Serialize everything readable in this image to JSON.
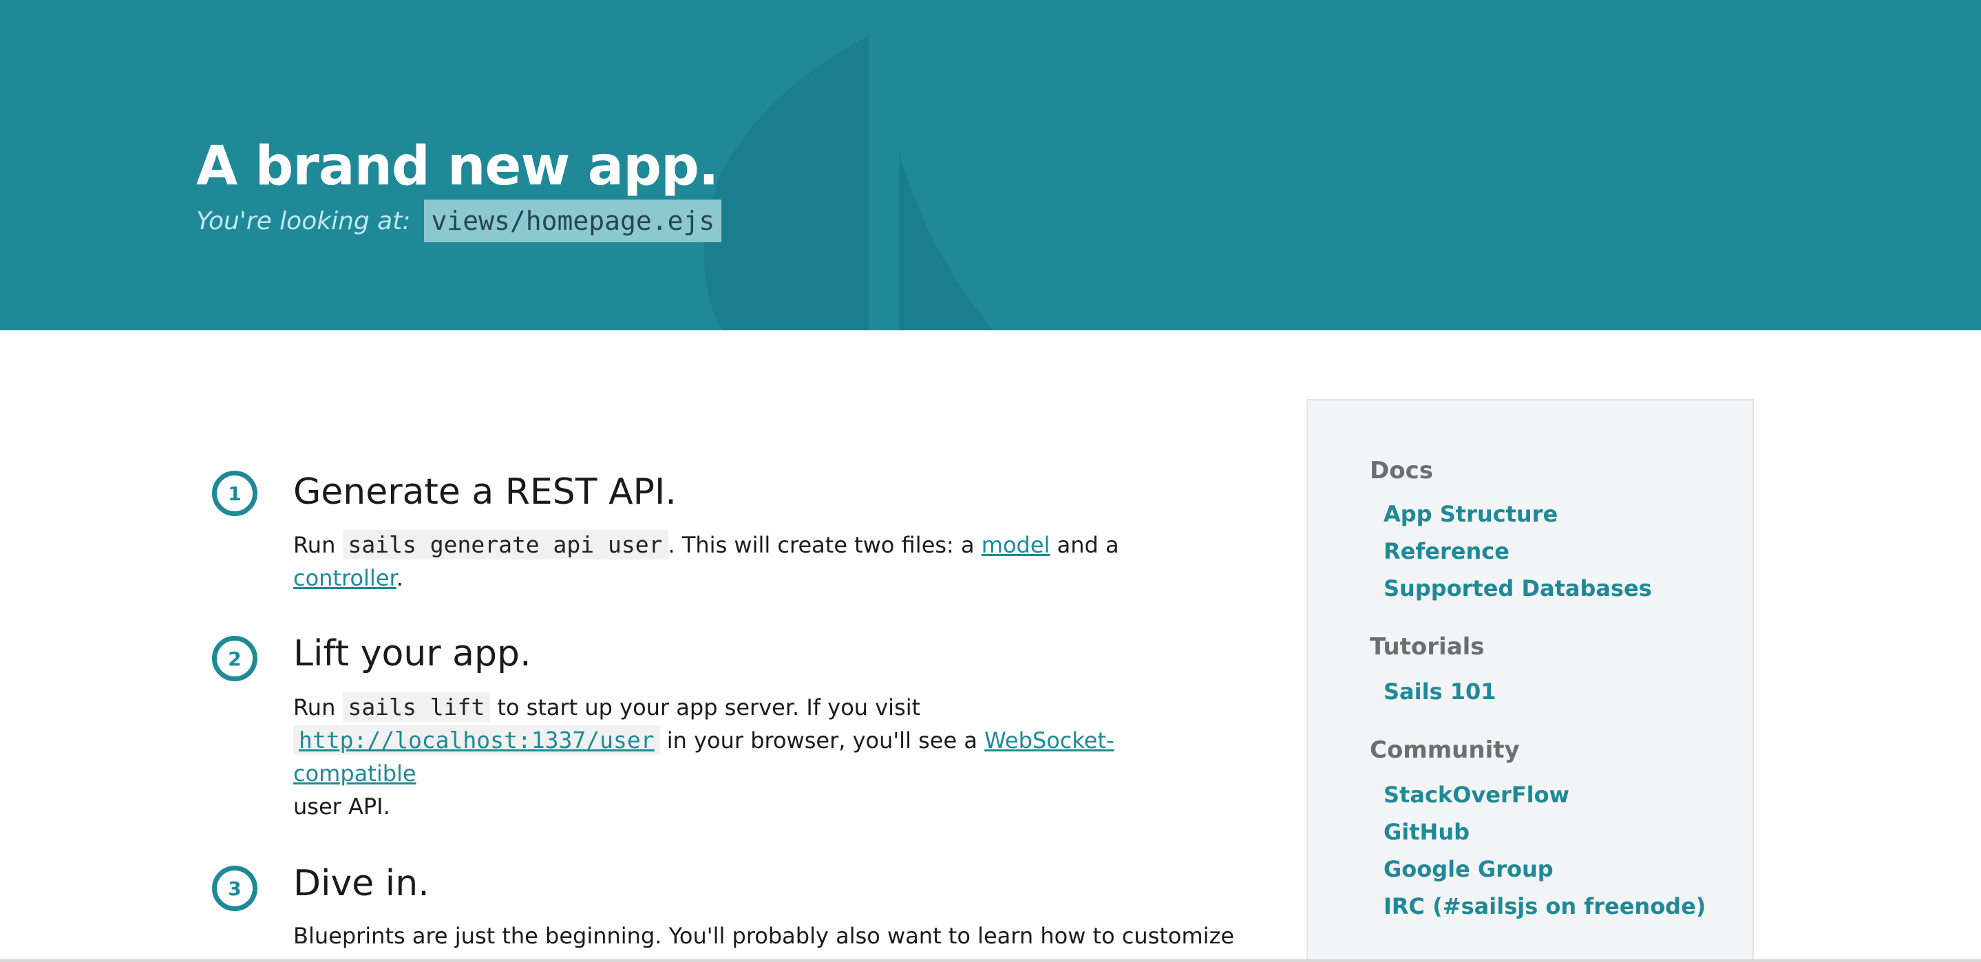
{
  "header": {
    "title": "A brand new app.",
    "sub_label": "You're looking at:",
    "sub_code": "views/homepage.ejs",
    "bg_color": "#1f8998"
  },
  "steps": [
    {
      "number": "1",
      "title": "Generate a REST API.",
      "text_run": "Run",
      "code": "sails generate api user",
      "text_mid": ". This will create two files: a",
      "link_model": "model",
      "text_and": "and a",
      "link_controller": "controller",
      "text_end": "."
    },
    {
      "number": "2",
      "title": "Lift your app.",
      "text_run": "Run",
      "code": "sails lift",
      "text_mid": "to start up your app server. If you visit",
      "link_url": "http://localhost:1337/user",
      "text_browser": "in your browser, you'll see a",
      "link_ws": "WebSocket-compatible",
      "text_end": "user API."
    },
    {
      "number": "3",
      "title": "Dive in.",
      "text": "Blueprints are just the beginning. You'll probably also want to learn how to customize"
    }
  ],
  "sidebar": {
    "sections": [
      {
        "heading": "Docs",
        "links": [
          "App Structure",
          "Reference",
          "Supported Databases"
        ]
      },
      {
        "heading": "Tutorials",
        "links": [
          "Sails 101"
        ]
      },
      {
        "heading": "Community",
        "links": [
          "StackOverFlow",
          "GitHub",
          "Google Group",
          "IRC (#sailsjs on freenode)"
        ]
      }
    ]
  },
  "colors": {
    "accent": "#1f8998",
    "sidebar_bg": "#f3f4f5",
    "code_bg": "#f1f1f1"
  }
}
